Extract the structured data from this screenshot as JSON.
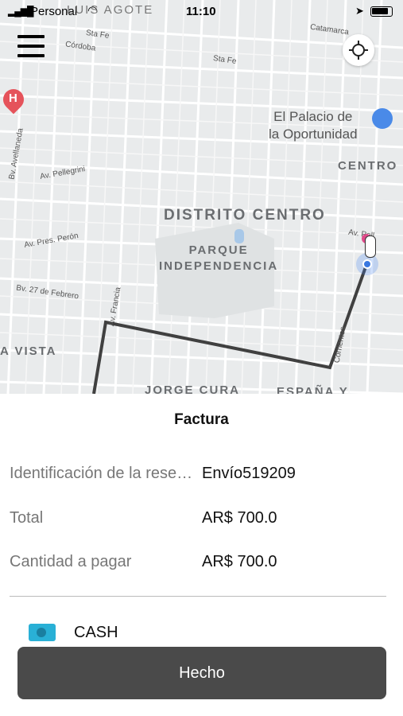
{
  "status_bar": {
    "carrier": "Personal",
    "time": "11:10"
  },
  "map": {
    "district": "DISTRITO CENTRO",
    "park_line1": "PARQUE",
    "park_line2": "INDEPENDENCIA",
    "centro": "CENTRO",
    "poi_line1": "El Palacio de",
    "poi_line2": "la Oportunidad",
    "jorge_cura": "JORGE CURA",
    "espana": "ESPAÑA Y",
    "vista": "A VISTA",
    "top_label": "LUIS AGOTE",
    "streets": {
      "sta_fe_1": "Sta Fe",
      "cordoba": "Córdoba",
      "sta_fe_2": "Sta Fe",
      "catamarca": "Catamarca",
      "pellegrini": "Av. Pellegrini",
      "pellegrini_right": "Av. Pell",
      "peron": "Av. Pres. Perón",
      "febrero": "Bv. 27 de Febrero",
      "francia": "Av. Francia",
      "corrientes": "Corrientes",
      "avellaneda": "Bv. Avellaneda"
    }
  },
  "sheet": {
    "title": "Factura",
    "rows": [
      {
        "label": "Identificación de la reserva",
        "value": "Envío519209"
      },
      {
        "label": "Total",
        "value": "AR$ 700.0"
      },
      {
        "label": "Cantidad a pagar",
        "value": "AR$ 700.0"
      }
    ],
    "payment_method": "CASH",
    "done_label": "Hecho"
  }
}
